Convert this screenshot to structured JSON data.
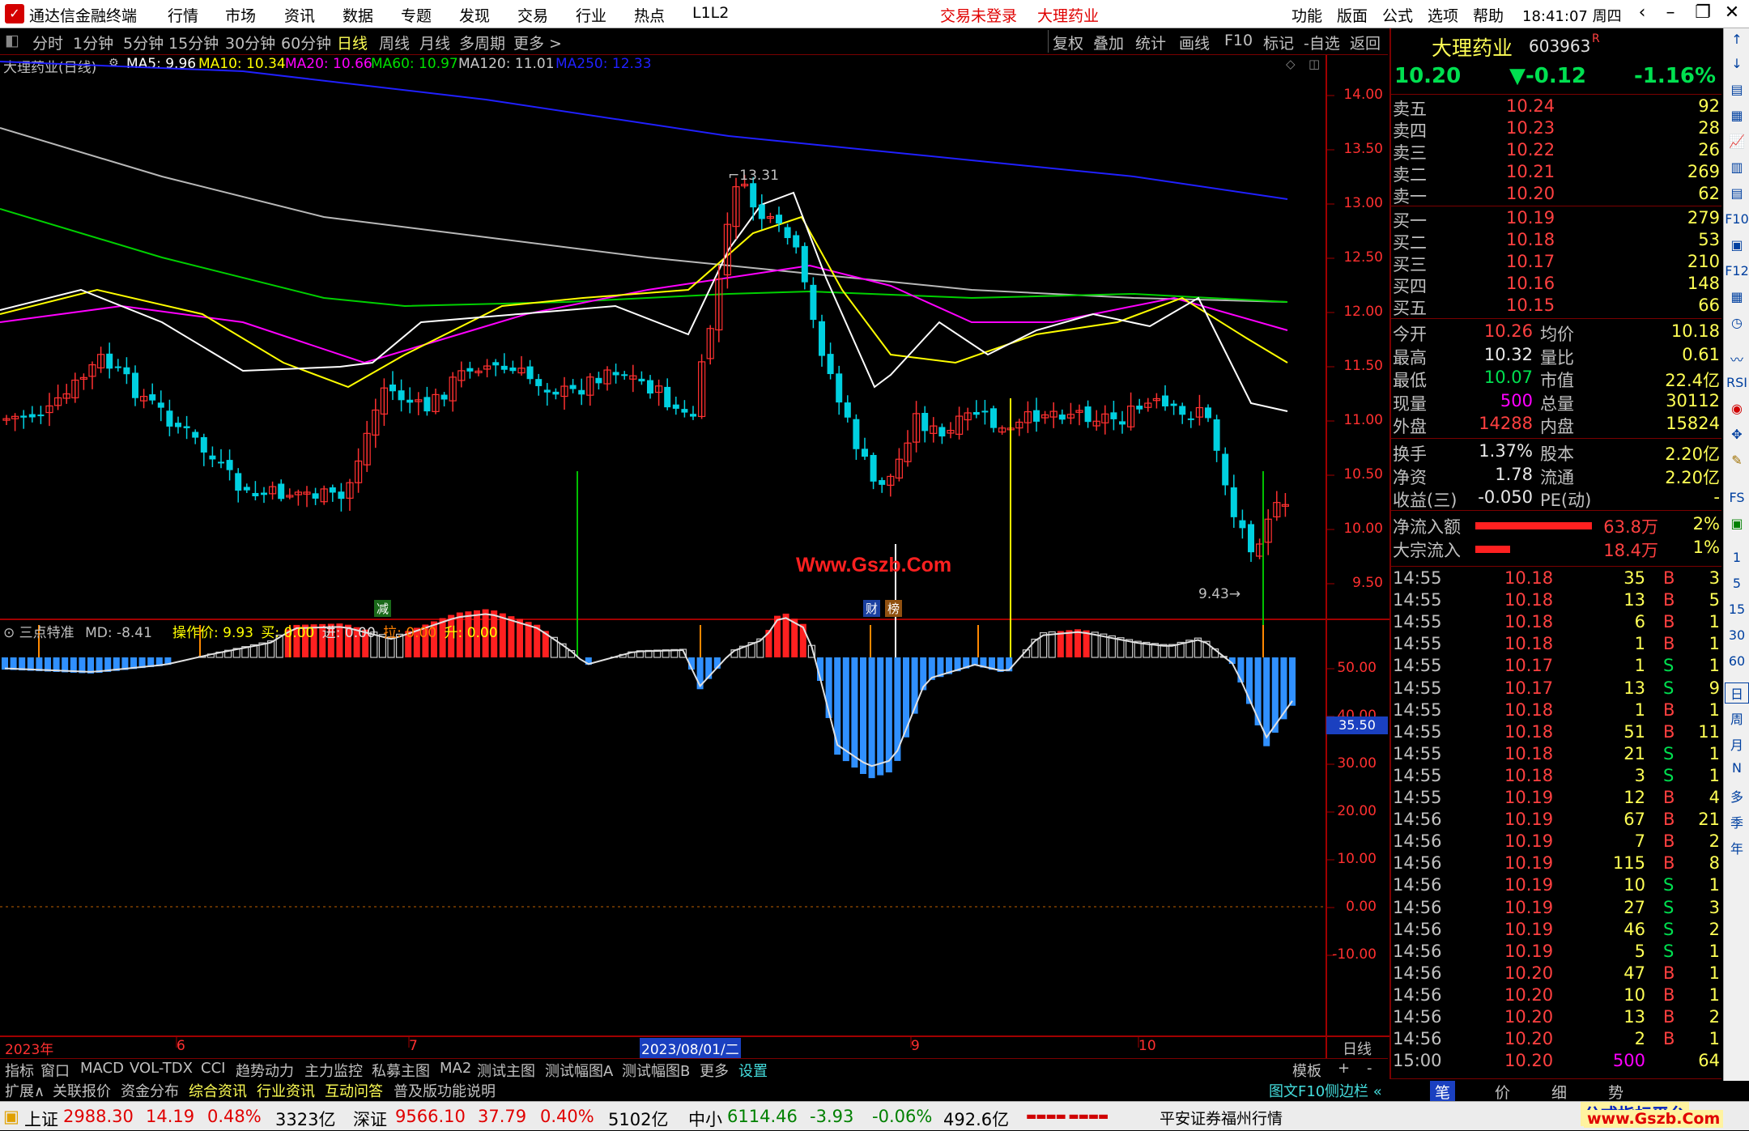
{
  "titlebar": {
    "app_name": "通达信金融终端",
    "menu": [
      "行情",
      "市场",
      "资讯",
      "数据",
      "专题",
      "发现",
      "交易",
      "行业",
      "热点",
      "L1L2"
    ],
    "alerts": [
      "交易未登录",
      "大理药业"
    ],
    "right_menu": [
      "功能",
      "版面",
      "公式",
      "选项",
      "帮助"
    ],
    "clock": "18:41:07 周四"
  },
  "period_bar": {
    "items": [
      "分时",
      "1分钟",
      "5分钟",
      "15分钟",
      "30分钟",
      "60分钟",
      "日线",
      "周线",
      "月线",
      "多周期",
      "更多 >"
    ],
    "active": "日线",
    "tools": [
      "复权",
      "叠加",
      "统计",
      "画线",
      "F10",
      "标记",
      "-自选",
      "返回"
    ]
  },
  "main_chart": {
    "title": "大理药业(日线)",
    "ma": [
      {
        "label": "MA5: 9.96",
        "color": "#ffffff"
      },
      {
        "label": "MA10: 10.34",
        "color": "#ffff00"
      },
      {
        "label": "MA20: 10.66",
        "color": "#ff00ff"
      },
      {
        "label": "MA60: 10.97",
        "color": "#00e000"
      },
      {
        "label": "MA120: 11.01",
        "color": "#c8c8c8"
      },
      {
        "label": "MA250: 12.33",
        "color": "#2020ff"
      }
    ],
    "price_ticks": [
      "14.00",
      "13.50",
      "13.00",
      "12.50",
      "12.00",
      "11.50",
      "11.00",
      "10.50",
      "10.00",
      "9.50"
    ],
    "high_label": "13.31",
    "low_label": "9.43",
    "watermark": "Www.Gszb.Com",
    "markers": [
      "减",
      "财",
      "榜"
    ]
  },
  "indicator": {
    "name": "三点特准",
    "md": "MD: -8.41",
    "values": [
      {
        "label": "操作价: 9.93",
        "color": "#ffff00"
      },
      {
        "label": "买: 0.00",
        "color": "#ffff00"
      },
      {
        "label": "进: 0.00",
        "color": "#e0e0e0"
      },
      {
        "label": "拉: 0.00",
        "color": "#ff8000"
      },
      {
        "label": "升: 0.00",
        "color": "#ffff00"
      }
    ],
    "ticks": [
      "50.00",
      "40.00",
      "30.00",
      "20.00",
      "10.00",
      "0.00",
      "-10.00"
    ],
    "cursor_value": "35.50"
  },
  "date_axis": {
    "labels": [
      "2023年",
      "6",
      "7",
      "2023/08/01/二",
      "9",
      "10"
    ],
    "period": "日线"
  },
  "tab_bar_1": {
    "items": [
      "指标",
      "窗口",
      "MACD",
      "VOL-TDX",
      "CCI",
      "趋势动力",
      "主力监控",
      "私募主图",
      "MA2",
      "测试主图",
      "测试幅图A",
      "测试幅图B",
      "更多",
      "设置"
    ],
    "right": [
      "模板",
      "+",
      "-"
    ]
  },
  "tab_bar_2": {
    "items": [
      "扩展∧",
      "关联报价",
      "资金分布",
      "综合资讯",
      "行业资讯",
      "互动问答",
      "普及版功能说明"
    ],
    "right": [
      "图文F10",
      "侧边栏 «"
    ]
  },
  "quote": {
    "name": "大理药业",
    "code": "603963",
    "flag": "R",
    "price": "10.20",
    "change": "▼-0.12",
    "pct": "-1.16%",
    "asks": [
      {
        "label": "卖五",
        "price": "10.24",
        "vol": "92"
      },
      {
        "label": "卖四",
        "price": "10.23",
        "vol": "28"
      },
      {
        "label": "卖三",
        "price": "10.22",
        "vol": "26"
      },
      {
        "label": "卖二",
        "price": "10.21",
        "vol": "269"
      },
      {
        "label": "卖一",
        "price": "10.20",
        "vol": "62"
      }
    ],
    "bids": [
      {
        "label": "买一",
        "price": "10.19",
        "vol": "279"
      },
      {
        "label": "买二",
        "price": "10.18",
        "vol": "53"
      },
      {
        "label": "买三",
        "price": "10.17",
        "vol": "210"
      },
      {
        "label": "买四",
        "price": "10.16",
        "vol": "148"
      },
      {
        "label": "买五",
        "price": "10.15",
        "vol": "66"
      }
    ],
    "stats1": [
      {
        "l1": "今开",
        "v1": "10.26",
        "c1": "red",
        "l2": "均价",
        "v2": "10.18",
        "c2": "yel"
      },
      {
        "l1": "最高",
        "v1": "10.32",
        "c1": "wht",
        "l2": "量比",
        "v2": "0.61",
        "c2": "yel"
      },
      {
        "l1": "最低",
        "v1": "10.07",
        "c1": "green",
        "l2": "市值",
        "v2": "22.4亿",
        "c2": "wht"
      },
      {
        "l1": "现量",
        "v1": "500",
        "c1": "mag",
        "l2": "总量",
        "v2": "30112",
        "c2": "yel"
      },
      {
        "l1": "外盘",
        "v1": "14288",
        "c1": "red",
        "l2": "内盘",
        "v2": "15824",
        "c2": "green"
      }
    ],
    "stats2": [
      {
        "l1": "换手",
        "v1": "1.37%",
        "c1": "wht",
        "l2": "股本",
        "v2": "2.20亿",
        "c2": "wht"
      },
      {
        "l1": "净资",
        "v1": "1.78",
        "c1": "wht",
        "l2": "流通",
        "v2": "2.20亿",
        "c2": "wht"
      },
      {
        "l1": "收益(三)",
        "v1": "-0.050",
        "c1": "wht",
        "l2": "PE(动)",
        "v2": "-",
        "c2": "wht"
      }
    ],
    "flows": [
      {
        "label": "净流入额",
        "value": "63.8万",
        "pct": "2%",
        "bar": 0.6
      },
      {
        "label": "大宗流入",
        "value": "18.4万",
        "pct": "1%",
        "bar": 0.18
      }
    ],
    "ticks": [
      {
        "t": "14:55",
        "p": "10.18",
        "v": "35",
        "bs": "B",
        "n": "3"
      },
      {
        "t": "14:55",
        "p": "10.18",
        "v": "13",
        "bs": "B",
        "n": "5"
      },
      {
        "t": "14:55",
        "p": "10.18",
        "v": "6",
        "bs": "B",
        "n": "1"
      },
      {
        "t": "14:55",
        "p": "10.18",
        "v": "1",
        "bs": "B",
        "n": "1"
      },
      {
        "t": "14:55",
        "p": "10.17",
        "v": "1",
        "bs": "S",
        "n": "1"
      },
      {
        "t": "14:55",
        "p": "10.17",
        "v": "13",
        "bs": "S",
        "n": "9"
      },
      {
        "t": "14:55",
        "p": "10.18",
        "v": "1",
        "bs": "B",
        "n": "1"
      },
      {
        "t": "14:55",
        "p": "10.18",
        "v": "51",
        "bs": "B",
        "n": "11"
      },
      {
        "t": "14:55",
        "p": "10.18",
        "v": "21",
        "bs": "S",
        "n": "1"
      },
      {
        "t": "14:55",
        "p": "10.18",
        "v": "3",
        "bs": "S",
        "n": "1"
      },
      {
        "t": "14:55",
        "p": "10.19",
        "v": "12",
        "bs": "B",
        "n": "4"
      },
      {
        "t": "14:56",
        "p": "10.19",
        "v": "67",
        "bs": "B",
        "n": "21"
      },
      {
        "t": "14:56",
        "p": "10.19",
        "v": "7",
        "bs": "B",
        "n": "2"
      },
      {
        "t": "14:56",
        "p": "10.19",
        "v": "115",
        "bs": "B",
        "n": "8"
      },
      {
        "t": "14:56",
        "p": "10.19",
        "v": "10",
        "bs": "S",
        "n": "1"
      },
      {
        "t": "14:56",
        "p": "10.19",
        "v": "27",
        "bs": "S",
        "n": "3"
      },
      {
        "t": "14:56",
        "p": "10.19",
        "v": "46",
        "bs": "S",
        "n": "2"
      },
      {
        "t": "14:56",
        "p": "10.19",
        "v": "5",
        "bs": "S",
        "n": "1"
      },
      {
        "t": "14:56",
        "p": "10.20",
        "v": "47",
        "bs": "B",
        "n": "1"
      },
      {
        "t": "14:56",
        "p": "10.20",
        "v": "10",
        "bs": "B",
        "n": "1"
      },
      {
        "t": "14:56",
        "p": "10.20",
        "v": "13",
        "bs": "B",
        "n": "2"
      },
      {
        "t": "14:56",
        "p": "10.20",
        "v": "2",
        "bs": "B",
        "n": "1"
      },
      {
        "t": "15:00",
        "p": "10.20",
        "v": "500",
        "bs": "",
        "n": "64"
      }
    ],
    "bottom_tabs": [
      "笔",
      "价",
      "细",
      "势"
    ]
  },
  "side_tools": [
    "↑",
    "↓",
    "1",
    "5",
    "15",
    "30",
    "60",
    "日",
    "周",
    "月",
    "N",
    "多",
    "季",
    "年"
  ],
  "statusbar": {
    "indices": [
      {
        "name": "上证",
        "val": "2988.30",
        "chg": "14.19",
        "pct": "0.48%",
        "amt": "3323亿",
        "up": true
      },
      {
        "name": "深证",
        "val": "9566.10",
        "chg": "37.79",
        "pct": "0.40%",
        "amt": "5102亿",
        "up": true
      },
      {
        "name": "中小",
        "val": "6114.46",
        "chg": "-3.93",
        "pct": "-0.06%",
        "amt": "492.6亿",
        "up": false
      }
    ],
    "broker": "平安证券福州行情",
    "brand": "公式指标平台",
    "brand_url": "www.Gszb.Com"
  }
}
